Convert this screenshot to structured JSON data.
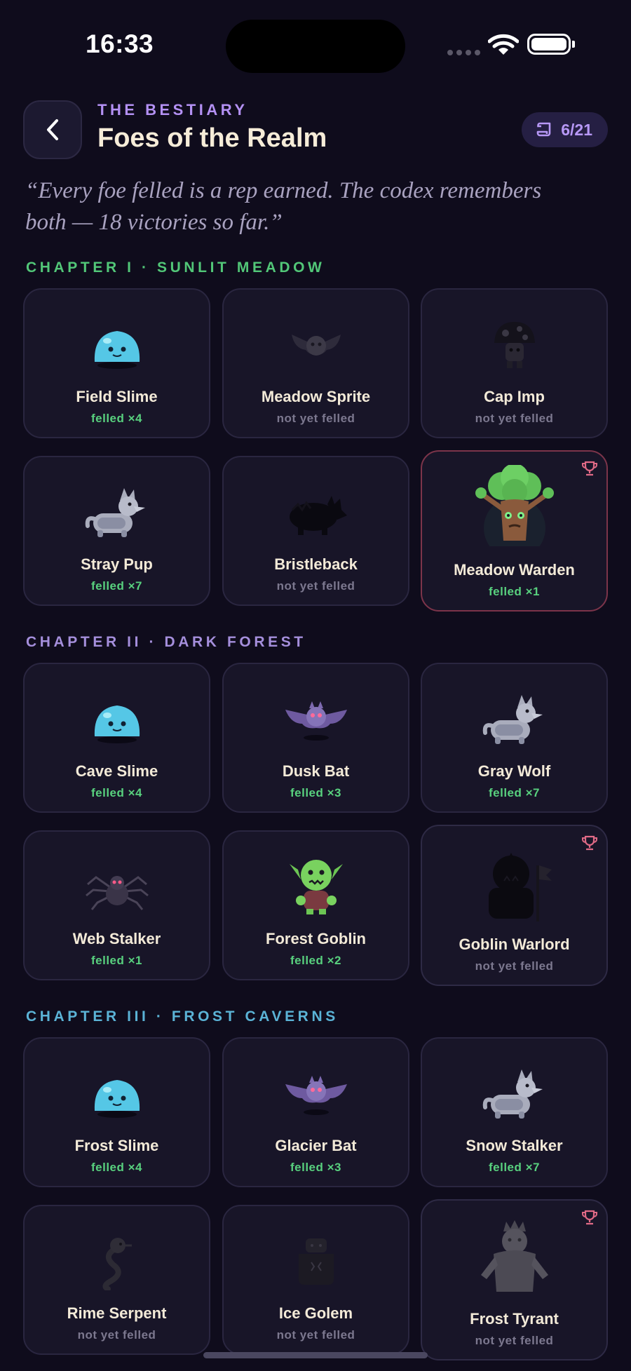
{
  "status_bar": {
    "time": "16:33"
  },
  "header": {
    "eyebrow": "THE BESTIARY",
    "title": "Foes of the Realm",
    "count": "6/21",
    "quote": "“Every foe felled is a rep earned. The codex remembers both — 18 victories so far.”"
  },
  "colors": {
    "chapter_1": "#52c778",
    "chapter_2": "#a58fdc",
    "chapter_3": "#5bb3d6",
    "felled": "#58d07e",
    "locked": "#7c788f",
    "boss_border": "#7c344a",
    "trophy": "#e06a86"
  },
  "chapters": [
    {
      "label": "CHAPTER I · SUNLIT MEADOW",
      "cards": [
        {
          "name": "Field Slime",
          "status": "felled ×4",
          "icon": "slime-icon"
        },
        {
          "name": "Meadow Sprite",
          "status": "not yet felled",
          "icon": "bat-icon"
        },
        {
          "name": "Cap Imp",
          "status": "not yet felled",
          "icon": "mushroom-icon"
        },
        {
          "name": "Stray Pup",
          "status": "felled ×7",
          "icon": "wolf-icon"
        },
        {
          "name": "Bristleback",
          "status": "not yet felled",
          "icon": "boar-icon"
        },
        {
          "name": "Meadow Warden",
          "status": "felled ×1",
          "icon": "treant-icon",
          "boss": true
        }
      ]
    },
    {
      "label": "CHAPTER II · DARK FOREST",
      "cards": [
        {
          "name": "Cave Slime",
          "status": "felled ×4",
          "icon": "slime-icon"
        },
        {
          "name": "Dusk Bat",
          "status": "felled ×3",
          "icon": "bat-icon"
        },
        {
          "name": "Gray Wolf",
          "status": "felled ×7",
          "icon": "wolf-icon"
        },
        {
          "name": "Web Stalker",
          "status": "felled ×1",
          "icon": "spider-icon"
        },
        {
          "name": "Forest Goblin",
          "status": "felled ×2",
          "icon": "goblin-icon"
        },
        {
          "name": "Goblin Warlord",
          "status": "not yet felled",
          "icon": "warlord-icon",
          "boss": true
        }
      ]
    },
    {
      "label": "CHAPTER III · FROST CAVERNS",
      "cards": [
        {
          "name": "Frost Slime",
          "status": "felled ×4",
          "icon": "slime-icon"
        },
        {
          "name": "Glacier Bat",
          "status": "felled ×3",
          "icon": "bat-icon"
        },
        {
          "name": "Snow Stalker",
          "status": "felled ×7",
          "icon": "wolf-icon"
        },
        {
          "name": "Rime Serpent",
          "status": "not yet felled",
          "icon": "serpent-icon"
        },
        {
          "name": "Ice Golem",
          "status": "not yet felled",
          "icon": "golem-icon"
        },
        {
          "name": "Frost Tyrant",
          "status": "not yet felled",
          "icon": "tyrant-icon",
          "boss": true
        }
      ]
    }
  ]
}
